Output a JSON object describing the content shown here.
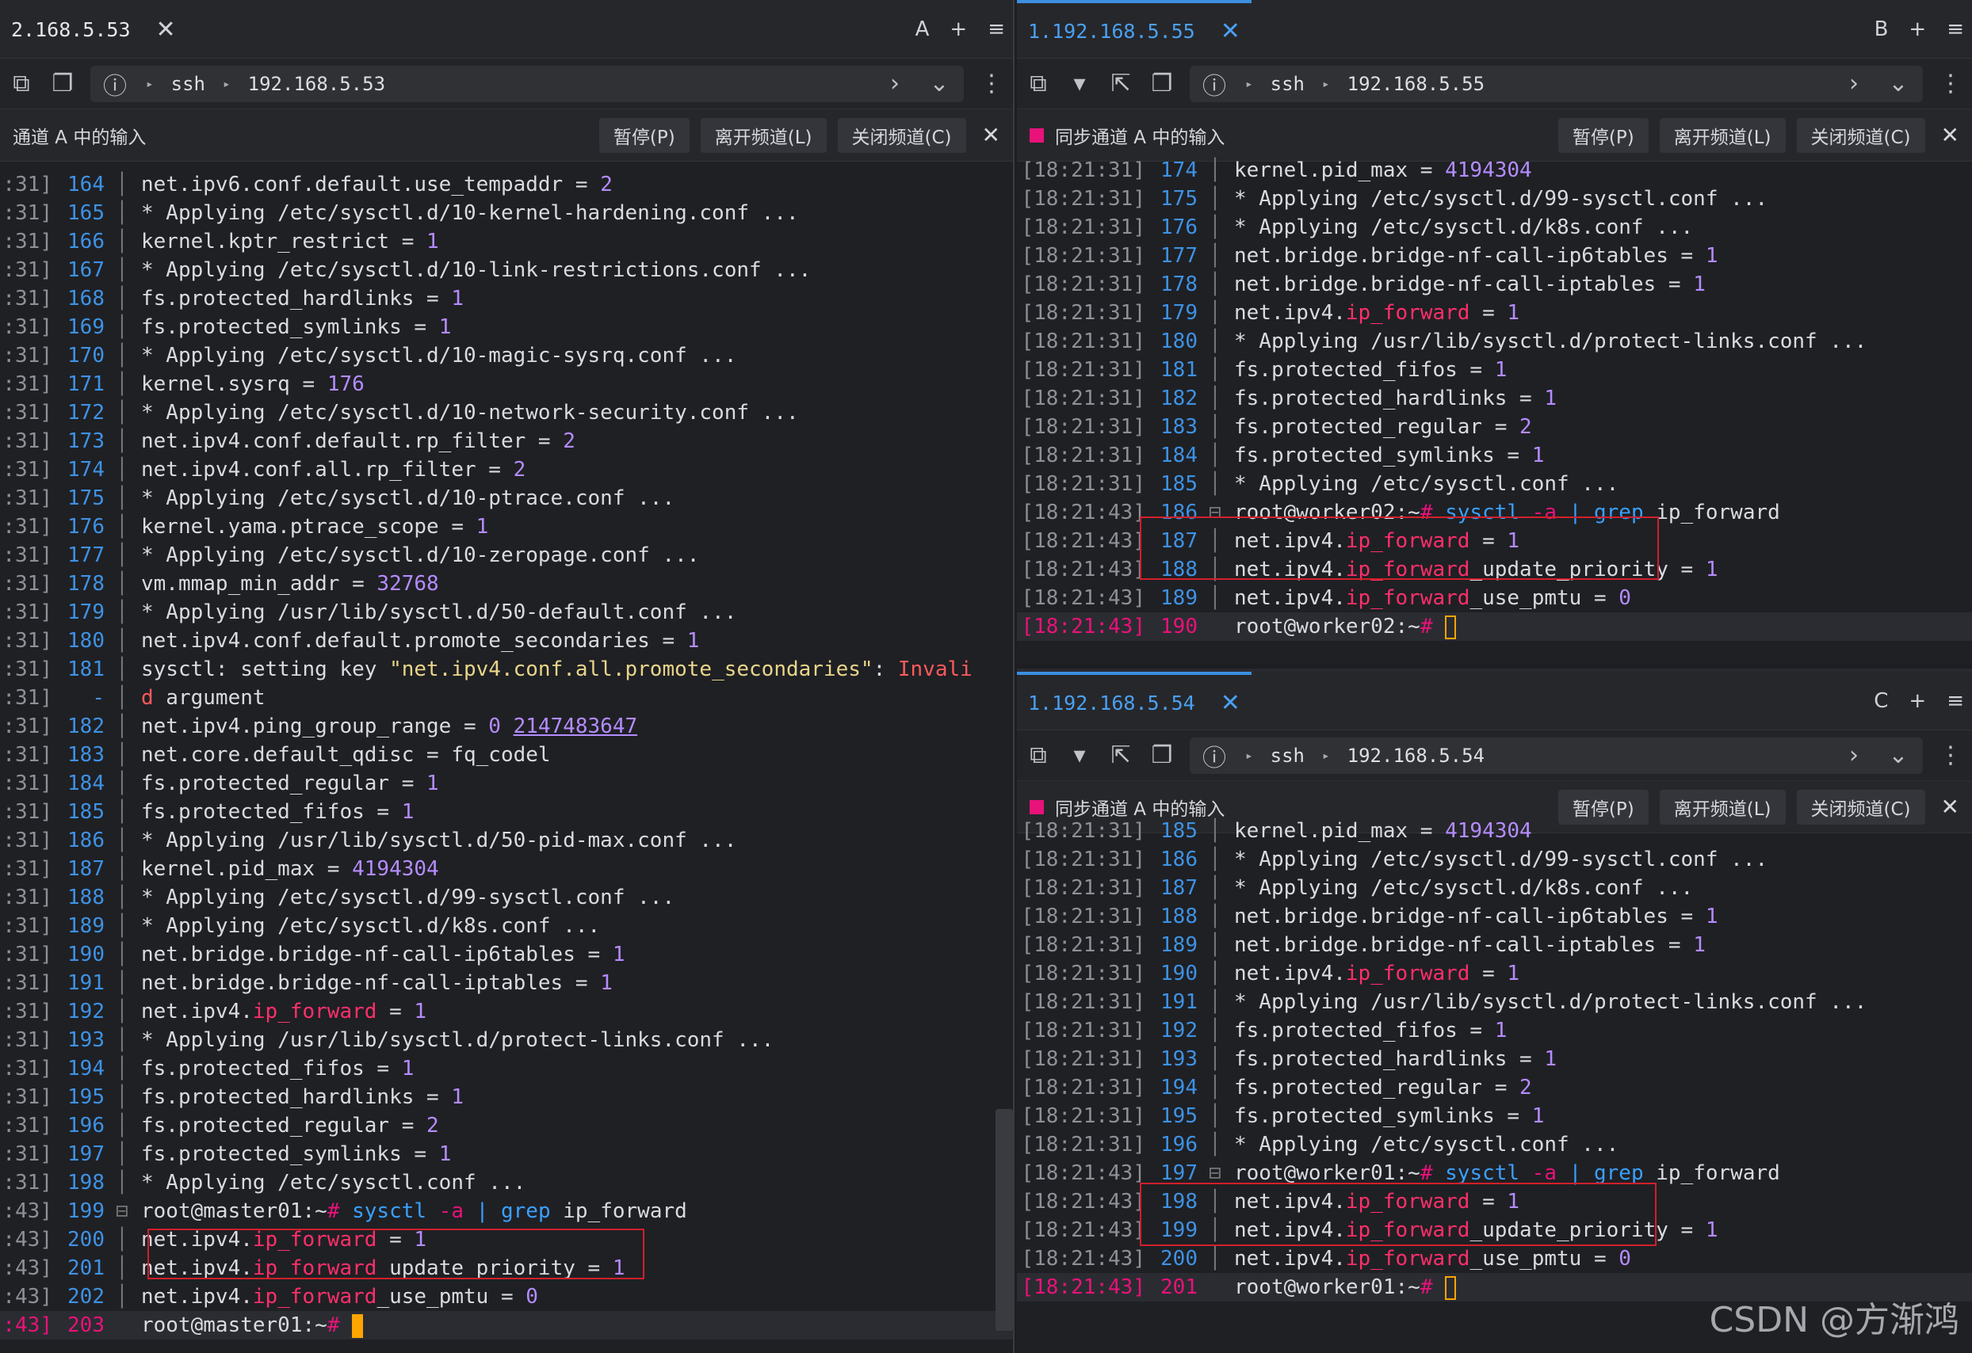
{
  "pane_a": {
    "tab": "2.168.5.53",
    "tab_close": "✕",
    "right_label": "A",
    "plus": "+",
    "menu": "≡",
    "protocol": "ssh",
    "host": "192.168.5.53",
    "sync_text": "通道 A 中的输入",
    "pause": "暂停(P)",
    "leave": "离开频道(L)",
    "close_channel": "关闭频道(C)",
    "lines": [
      {
        "ts": ":31]",
        "ln": "164",
        "t": "net.ipv6.conf.default.use_tempaddr = 2"
      },
      {
        "ts": ":31]",
        "ln": "165",
        "t": "* Applying /etc/sysctl.d/10-kernel-hardening.conf ..."
      },
      {
        "ts": ":31]",
        "ln": "166",
        "t": "kernel.kptr_restrict = 1"
      },
      {
        "ts": ":31]",
        "ln": "167",
        "t": "* Applying /etc/sysctl.d/10-link-restrictions.conf ..."
      },
      {
        "ts": ":31]",
        "ln": "168",
        "t": "fs.protected_hardlinks = 1"
      },
      {
        "ts": ":31]",
        "ln": "169",
        "t": "fs.protected_symlinks = 1"
      },
      {
        "ts": ":31]",
        "ln": "170",
        "t": "* Applying /etc/sysctl.d/10-magic-sysrq.conf ..."
      },
      {
        "ts": ":31]",
        "ln": "171",
        "t": "kernel.sysrq = 176"
      },
      {
        "ts": ":31]",
        "ln": "172",
        "t": "* Applying /etc/sysctl.d/10-network-security.conf ..."
      },
      {
        "ts": ":31]",
        "ln": "173",
        "t": "net.ipv4.conf.default.rp_filter = 2"
      },
      {
        "ts": ":31]",
        "ln": "174",
        "t": "net.ipv4.conf.all.rp_filter = 2"
      },
      {
        "ts": ":31]",
        "ln": "175",
        "t": "* Applying /etc/sysctl.d/10-ptrace.conf ..."
      },
      {
        "ts": ":31]",
        "ln": "176",
        "t": "kernel.yama.ptrace_scope = 1"
      },
      {
        "ts": ":31]",
        "ln": "177",
        "t": "* Applying /etc/sysctl.d/10-zeropage.conf ..."
      },
      {
        "ts": ":31]",
        "ln": "178",
        "t": "vm.mmap_min_addr = 32768"
      },
      {
        "ts": ":31]",
        "ln": "179",
        "t": "* Applying /usr/lib/sysctl.d/50-default.conf ..."
      },
      {
        "ts": ":31]",
        "ln": "180",
        "t": "net.ipv4.conf.default.promote_secondaries = 1"
      },
      {
        "ts": ":31]",
        "ln": "181",
        "t": "sysctl: setting key \"net.ipv4.conf.all.promote_secondaries\": Invali"
      },
      {
        "ts": ":31]",
        "ln": "-",
        "t": "d argument"
      },
      {
        "ts": ":31]",
        "ln": "182",
        "t": "net.ipv4.ping_group_range = 0 2147483647"
      },
      {
        "ts": ":31]",
        "ln": "183",
        "t": "net.core.default_qdisc = fq_codel"
      },
      {
        "ts": ":31]",
        "ln": "184",
        "t": "fs.protected_regular = 1"
      },
      {
        "ts": ":31]",
        "ln": "185",
        "t": "fs.protected_fifos = 1"
      },
      {
        "ts": ":31]",
        "ln": "186",
        "t": "* Applying /usr/lib/sysctl.d/50-pid-max.conf ..."
      },
      {
        "ts": ":31]",
        "ln": "187",
        "t": "kernel.pid_max = 4194304"
      },
      {
        "ts": ":31]",
        "ln": "188",
        "t": "* Applying /etc/sysctl.d/99-sysctl.conf ..."
      },
      {
        "ts": ":31]",
        "ln": "189",
        "t": "* Applying /etc/sysctl.d/k8s.conf ..."
      },
      {
        "ts": ":31]",
        "ln": "190",
        "t": "net.bridge.bridge-nf-call-ip6tables = 1"
      },
      {
        "ts": ":31]",
        "ln": "191",
        "t": "net.bridge.bridge-nf-call-iptables = 1"
      },
      {
        "ts": ":31]",
        "ln": "192",
        "t": "net.ipv4.ip_forward = 1"
      },
      {
        "ts": ":31]",
        "ln": "193",
        "t": "* Applying /usr/lib/sysctl.d/protect-links.conf ..."
      },
      {
        "ts": ":31]",
        "ln": "194",
        "t": "fs.protected_fifos = 1"
      },
      {
        "ts": ":31]",
        "ln": "195",
        "t": "fs.protected_hardlinks = 1"
      },
      {
        "ts": ":31]",
        "ln": "196",
        "t": "fs.protected_regular = 2"
      },
      {
        "ts": ":31]",
        "ln": "197",
        "t": "fs.protected_symlinks = 1"
      },
      {
        "ts": ":31]",
        "ln": "198",
        "t": "* Applying /etc/sysctl.conf ..."
      },
      {
        "ts": ":43]",
        "ln": "199",
        "t": "root@master01:~# sysctl -a | grep ip_forward"
      },
      {
        "ts": ":43]",
        "ln": "200",
        "t": "net.ipv4.ip_forward = 1"
      },
      {
        "ts": ":43]",
        "ln": "201",
        "t": "net.ipv4.ip_forward_update_priority = 1"
      },
      {
        "ts": ":43]",
        "ln": "202",
        "t": "net.ipv4.ip_forward_use_pmtu = 0"
      },
      {
        "ts": ":43]",
        "ln": "203",
        "t": "root@master01:~# "
      }
    ]
  },
  "pane_b": {
    "tab": "1.192.168.5.55",
    "tab_close": "✕",
    "right_label": "B",
    "plus": "+",
    "menu": "≡",
    "protocol": "ssh",
    "host": "192.168.5.55",
    "sync_text": "同步通道 A 中的输入",
    "pause": "暂停(P)",
    "leave": "离开频道(L)",
    "close_channel": "关闭频道(C)",
    "lines": [
      {
        "ts": "[18:21:31]",
        "ln": "174",
        "t": "kernel.pid_max = 4194304"
      },
      {
        "ts": "[18:21:31]",
        "ln": "175",
        "t": "* Applying /etc/sysctl.d/99-sysctl.conf ..."
      },
      {
        "ts": "[18:21:31]",
        "ln": "176",
        "t": "* Applying /etc/sysctl.d/k8s.conf ..."
      },
      {
        "ts": "[18:21:31]",
        "ln": "177",
        "t": "net.bridge.bridge-nf-call-ip6tables = 1"
      },
      {
        "ts": "[18:21:31]",
        "ln": "178",
        "t": "net.bridge.bridge-nf-call-iptables = 1"
      },
      {
        "ts": "[18:21:31]",
        "ln": "179",
        "t": "net.ipv4.ip_forward = 1"
      },
      {
        "ts": "[18:21:31]",
        "ln": "180",
        "t": "* Applying /usr/lib/sysctl.d/protect-links.conf ..."
      },
      {
        "ts": "[18:21:31]",
        "ln": "181",
        "t": "fs.protected_fifos = 1"
      },
      {
        "ts": "[18:21:31]",
        "ln": "182",
        "t": "fs.protected_hardlinks = 1"
      },
      {
        "ts": "[18:21:31]",
        "ln": "183",
        "t": "fs.protected_regular = 2"
      },
      {
        "ts": "[18:21:31]",
        "ln": "184",
        "t": "fs.protected_symlinks = 1"
      },
      {
        "ts": "[18:21:31]",
        "ln": "185",
        "t": "* Applying /etc/sysctl.conf ..."
      },
      {
        "ts": "[18:21:43]",
        "ln": "186",
        "t": "root@worker02:~# sysctl -a | grep ip_forward"
      },
      {
        "ts": "[18:21:43]",
        "ln": "187",
        "t": "net.ipv4.ip_forward = 1"
      },
      {
        "ts": "[18:21:43]",
        "ln": "188",
        "t": "net.ipv4.ip_forward_update_priority = 1"
      },
      {
        "ts": "[18:21:43]",
        "ln": "189",
        "t": "net.ipv4.ip_forward_use_pmtu = 0"
      },
      {
        "ts": "[18:21:43]",
        "ln": "190",
        "t": "root@worker02:~# "
      }
    ]
  },
  "pane_c": {
    "tab": "1.192.168.5.54",
    "tab_close": "✕",
    "right_label": "C",
    "plus": "+",
    "menu": "≡",
    "protocol": "ssh",
    "host": "192.168.5.54",
    "sync_text": "同步通道 A 中的输入",
    "pause": "暂停(P)",
    "leave": "离开频道(L)",
    "close_channel": "关闭频道(C)",
    "lines": [
      {
        "ts": "[18:21:31]",
        "ln": "185",
        "t": "kernel.pid_max = 4194304"
      },
      {
        "ts": "[18:21:31]",
        "ln": "186",
        "t": "* Applying /etc/sysctl.d/99-sysctl.conf ..."
      },
      {
        "ts": "[18:21:31]",
        "ln": "187",
        "t": "* Applying /etc/sysctl.d/k8s.conf ..."
      },
      {
        "ts": "[18:21:31]",
        "ln": "188",
        "t": "net.bridge.bridge-nf-call-ip6tables = 1"
      },
      {
        "ts": "[18:21:31]",
        "ln": "189",
        "t": "net.bridge.bridge-nf-call-iptables = 1"
      },
      {
        "ts": "[18:21:31]",
        "ln": "190",
        "t": "net.ipv4.ip_forward = 1"
      },
      {
        "ts": "[18:21:31]",
        "ln": "191",
        "t": "* Applying /usr/lib/sysctl.d/protect-links.conf ..."
      },
      {
        "ts": "[18:21:31]",
        "ln": "192",
        "t": "fs.protected_fifos = 1"
      },
      {
        "ts": "[18:21:31]",
        "ln": "193",
        "t": "fs.protected_hardlinks = 1"
      },
      {
        "ts": "[18:21:31]",
        "ln": "194",
        "t": "fs.protected_regular = 2"
      },
      {
        "ts": "[18:21:31]",
        "ln": "195",
        "t": "fs.protected_symlinks = 1"
      },
      {
        "ts": "[18:21:31]",
        "ln": "196",
        "t": "* Applying /etc/sysctl.conf ..."
      },
      {
        "ts": "[18:21:43]",
        "ln": "197",
        "t": "root@worker01:~# sysctl -a | grep ip_forward"
      },
      {
        "ts": "[18:21:43]",
        "ln": "198",
        "t": "net.ipv4.ip_forward = 1"
      },
      {
        "ts": "[18:21:43]",
        "ln": "199",
        "t": "net.ipv4.ip_forward_update_priority = 1"
      },
      {
        "ts": "[18:21:43]",
        "ln": "200",
        "t": "net.ipv4.ip_forward_use_pmtu = 0"
      },
      {
        "ts": "[18:21:43]",
        "ln": "201",
        "t": "root@worker01:~# "
      }
    ]
  },
  "watermark": "CSDN @方渐鸿",
  "colors": {
    "accent": "#3d8fe0",
    "prompt": "#e8127a",
    "highlight": "#ff2f6a",
    "number": "#b48cff",
    "cursor": "#ffa500",
    "box": "#d0202a"
  }
}
